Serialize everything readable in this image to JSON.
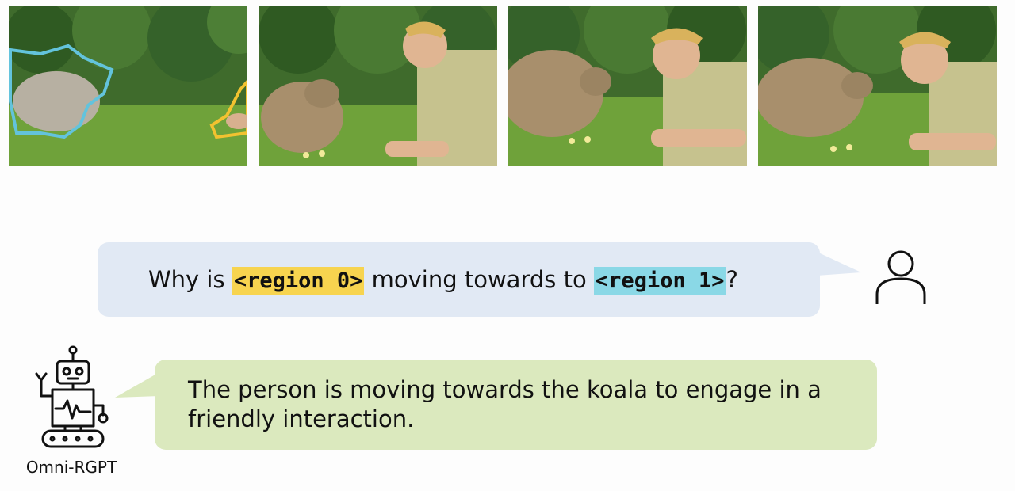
{
  "frames": [
    {
      "name": "frame-1"
    },
    {
      "name": "frame-2"
    },
    {
      "name": "frame-3"
    },
    {
      "name": "frame-4"
    }
  ],
  "region_colors": {
    "region_0": "#f2c230",
    "region_1": "#63c3dc"
  },
  "question": {
    "prefix": "Why is ",
    "region0": "<region 0>",
    "middle": " moving towards to ",
    "region1": "<region 1>",
    "suffix": "?"
  },
  "answer": {
    "text": "The person is moving towards the koala to engage in a friendly interaction."
  },
  "robot": {
    "label": "Omni-RGPT"
  },
  "icons": {
    "user": "user-icon",
    "robot": "robot-icon"
  }
}
